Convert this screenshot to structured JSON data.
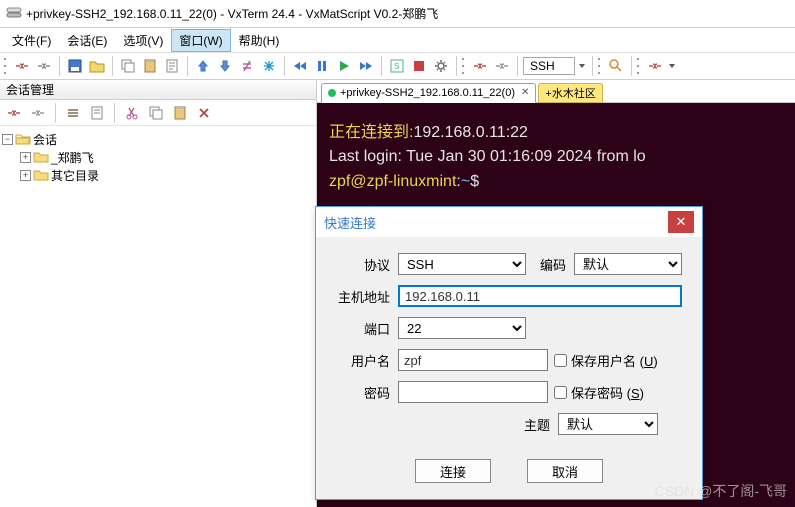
{
  "window": {
    "title": "+privkey-SSH2_192.168.0.11_22(0) - VxTerm 24.4 - VxMatScript V0.2-郑鹏飞"
  },
  "menu": {
    "file": "文件(F)",
    "session": "会话(E)",
    "options": "选项(V)",
    "window": "窗口(W)",
    "help": "帮助(H)"
  },
  "toolbar": {
    "protocol": "SSH"
  },
  "sidebar": {
    "title": "会话管理",
    "root": "会话",
    "items": [
      "_郑鹏飞",
      "其它目录"
    ]
  },
  "tabs": {
    "active": "+privkey-SSH2_192.168.0.11_22(0)",
    "other": "+水木社区"
  },
  "terminal": {
    "connect_prefix": "正在连接到:",
    "connect_addr": "192.168.0.11:22",
    "last_login": "Last login: Tue Jan 30 01:16:09 2024 from lo",
    "prompt_user": "zpf@zpf-linuxmint",
    "prompt_sep": ":",
    "prompt_path": "~",
    "prompt_symbol": "$"
  },
  "dialog": {
    "title": "快速连接",
    "labels": {
      "protocol": "协议",
      "encoding": "编码",
      "host": "主机地址",
      "port": "端口",
      "user": "用户名",
      "password": "密码",
      "theme": "主题",
      "save_user": "保存用户名 (",
      "save_user_u": "U",
      "save_user_end": ")",
      "save_pwd": "保存密码 (",
      "save_pwd_s": "S",
      "save_pwd_end": ")"
    },
    "values": {
      "protocol": "SSH",
      "encoding": "默认",
      "host": "192.168.0.11",
      "port": "22",
      "user": "zpf",
      "password": "",
      "theme": "默认"
    },
    "buttons": {
      "connect": "连接",
      "cancel": "取消"
    }
  },
  "watermark": "CSDN @不了阁-飞哥"
}
